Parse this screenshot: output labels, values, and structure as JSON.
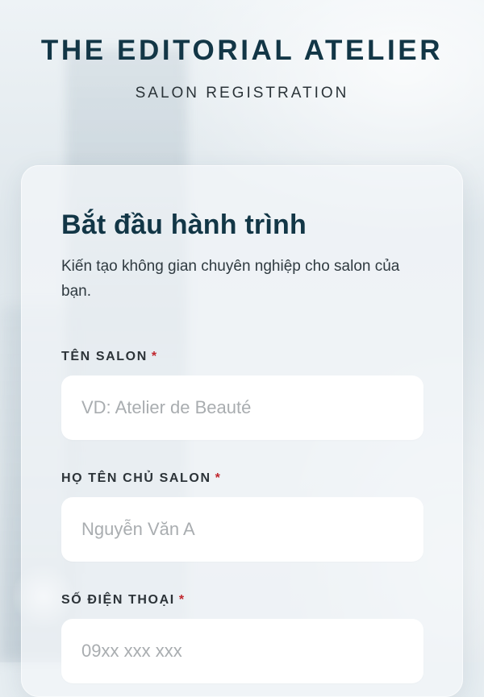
{
  "header": {
    "brand": "THE EDITORIAL ATELIER",
    "subtitle": "SALON REGISTRATION"
  },
  "form": {
    "title": "Bắt đầu hành trình",
    "description": "Kiến tạo không gian chuyên nghiệp cho salon của bạn.",
    "required_mark": "*",
    "fields": [
      {
        "label": "TÊN SALON",
        "placeholder": "VD: Atelier de Beauté",
        "value": ""
      },
      {
        "label": "HỌ TÊN CHỦ SALON",
        "placeholder": "Nguyễn Văn A",
        "value": ""
      },
      {
        "label": "SỐ ĐIỆN THOẠI",
        "placeholder": "09xx xxx xxx",
        "value": ""
      }
    ]
  },
  "colors": {
    "brand": "#123646",
    "required": "#c0262d",
    "placeholder": "#a9adb0",
    "card_bg": "#f4f7fa",
    "input_bg": "#ffffff"
  }
}
